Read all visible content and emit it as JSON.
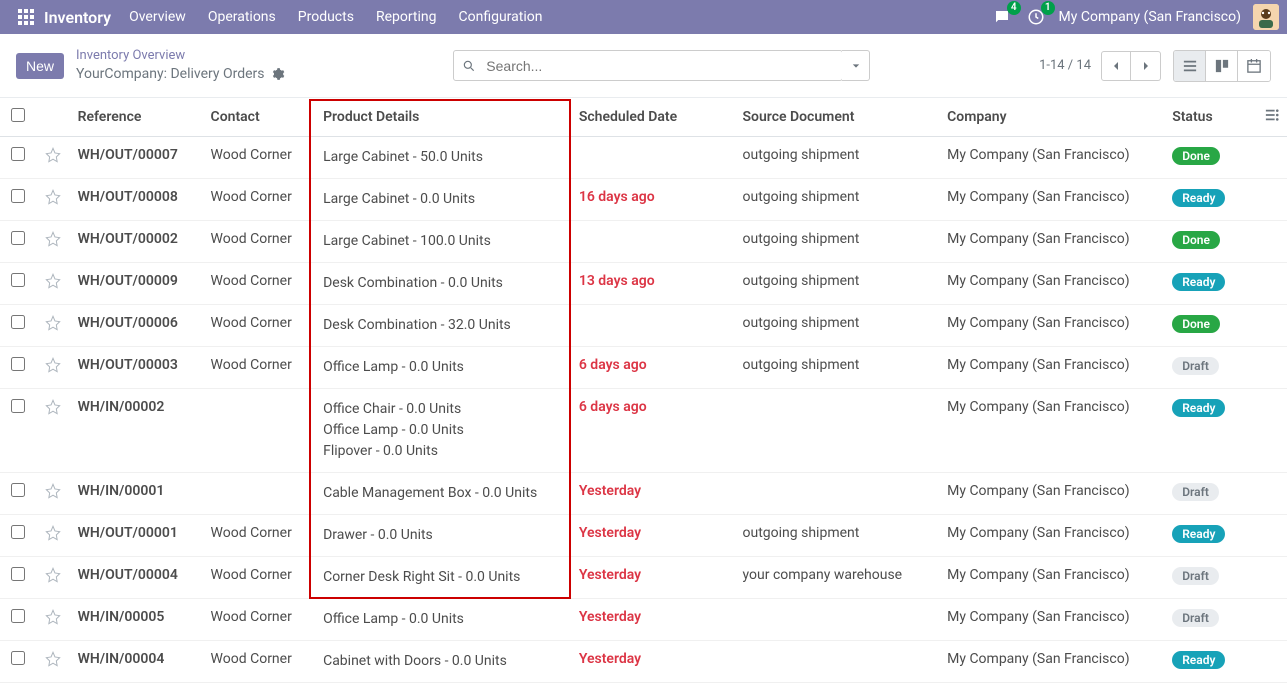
{
  "nav": {
    "brand": "Inventory",
    "items": [
      "Overview",
      "Operations",
      "Products",
      "Reporting",
      "Configuration"
    ],
    "chat_badge": "4",
    "activity_badge": "1",
    "company": "My Company (San Francisco)"
  },
  "controls": {
    "new_label": "New",
    "crumb_top": "Inventory Overview",
    "crumb_bottom": "YourCompany: Delivery Orders",
    "search_placeholder": "Search...",
    "pager": "1-14 / 14"
  },
  "columns": {
    "reference": "Reference",
    "contact": "Contact",
    "product": "Product Details",
    "date": "Scheduled Date",
    "source": "Source Document",
    "company": "Company",
    "status": "Status"
  },
  "rows": [
    {
      "ref": "WH/OUT/00007",
      "contact": "Wood Corner",
      "products": [
        "Large Cabinet - 50.0 Units"
      ],
      "date": "",
      "date_style": "",
      "source": "outgoing shipment",
      "company": "My Company (San Francisco)",
      "status": "Done",
      "status_class": "status-done"
    },
    {
      "ref": "WH/OUT/00008",
      "contact": "Wood Corner",
      "products": [
        "Large Cabinet - 0.0 Units"
      ],
      "date": "16 days ago",
      "date_style": "date-red",
      "source": "outgoing shipment",
      "company": "My Company (San Francisco)",
      "status": "Ready",
      "status_class": "status-ready"
    },
    {
      "ref": "WH/OUT/00002",
      "contact": "Wood Corner",
      "products": [
        "Large Cabinet - 100.0 Units"
      ],
      "date": "",
      "date_style": "",
      "source": "outgoing shipment",
      "company": "My Company (San Francisco)",
      "status": "Done",
      "status_class": "status-done"
    },
    {
      "ref": "WH/OUT/00009",
      "contact": "Wood Corner",
      "products": [
        "Desk Combination - 0.0 Units"
      ],
      "date": "13 days ago",
      "date_style": "date-red",
      "source": "outgoing shipment",
      "company": "My Company (San Francisco)",
      "status": "Ready",
      "status_class": "status-ready"
    },
    {
      "ref": "WH/OUT/00006",
      "contact": "Wood Corner",
      "products": [
        "Desk Combination - 32.0 Units"
      ],
      "date": "",
      "date_style": "",
      "source": "outgoing shipment",
      "company": "My Company (San Francisco)",
      "status": "Done",
      "status_class": "status-done"
    },
    {
      "ref": "WH/OUT/00003",
      "contact": "Wood Corner",
      "products": [
        "Office Lamp - 0.0 Units"
      ],
      "date": "6 days ago",
      "date_style": "date-red",
      "source": "outgoing shipment",
      "company": "My Company (San Francisco)",
      "status": "Draft",
      "status_class": "status-draft"
    },
    {
      "ref": "WH/IN/00002",
      "contact": "",
      "products": [
        "Office Chair - 0.0 Units",
        "Office Lamp - 0.0 Units",
        "Flipover - 0.0 Units"
      ],
      "date": "6 days ago",
      "date_style": "date-red",
      "source": "",
      "company": "My Company (San Francisco)",
      "status": "Ready",
      "status_class": "status-ready"
    },
    {
      "ref": "WH/IN/00001",
      "contact": "",
      "products": [
        "Cable Management Box - 0.0 Units"
      ],
      "date": "Yesterday",
      "date_style": "date-red",
      "source": "",
      "company": "My Company (San Francisco)",
      "status": "Draft",
      "status_class": "status-draft"
    },
    {
      "ref": "WH/OUT/00001",
      "contact": "Wood Corner",
      "products": [
        "Drawer - 0.0 Units"
      ],
      "date": "Yesterday",
      "date_style": "date-red",
      "source": "outgoing shipment",
      "company": "My Company (San Francisco)",
      "status": "Ready",
      "status_class": "status-ready"
    },
    {
      "ref": "WH/OUT/00004",
      "contact": "Wood Corner",
      "products": [
        "Corner Desk Right Sit - 0.0 Units"
      ],
      "date": "Yesterday",
      "date_style": "date-red",
      "source": "your company warehouse",
      "company": "My Company (San Francisco)",
      "status": "Draft",
      "status_class": "status-draft"
    },
    {
      "ref": "WH/IN/00005",
      "contact": "Wood Corner",
      "products": [
        "Office Lamp - 0.0 Units"
      ],
      "date": "Yesterday",
      "date_style": "date-red",
      "source": "",
      "company": "My Company (San Francisco)",
      "status": "Draft",
      "status_class": "status-draft"
    },
    {
      "ref": "WH/IN/00004",
      "contact": "Wood Corner",
      "products": [
        "Cabinet with Doors - 0.0 Units"
      ],
      "date": "Yesterday",
      "date_style": "date-red",
      "source": "",
      "company": "My Company (San Francisco)",
      "status": "Ready",
      "status_class": "status-ready"
    }
  ]
}
